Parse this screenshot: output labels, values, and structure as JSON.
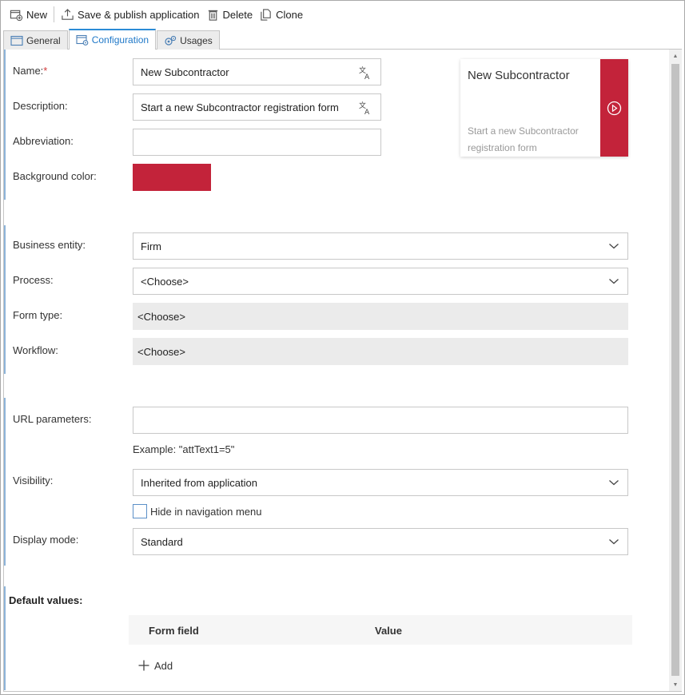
{
  "toolbar": {
    "new_label": "New",
    "save_publish_label": "Save & publish application",
    "delete_label": "Delete",
    "clone_label": "Clone"
  },
  "tabs": [
    {
      "label": "General",
      "icon": "window-icon"
    },
    {
      "label": "Configuration",
      "icon": "window-gear-icon"
    },
    {
      "label": "Usages",
      "icon": "gears-icon"
    }
  ],
  "form": {
    "name_label": "Name:",
    "required_mark": "*",
    "name_value": "New Subcontractor",
    "description_label": "Description:",
    "description_value": "Start a new Subcontractor registration form",
    "abbreviation_label": "Abbreviation:",
    "abbreviation_value": "",
    "background_color_label": "Background color:",
    "background_color": "#c3233a",
    "business_entity_label": "Business entity:",
    "business_entity_value": "Firm",
    "process_label": "Process:",
    "process_value": "<Choose>",
    "form_type_label": "Form type:",
    "form_type_value": "<Choose>",
    "workflow_label": "Workflow:",
    "workflow_value": "<Choose>",
    "url_parameters_label": "URL parameters:",
    "url_parameters_value": "",
    "url_example": "Example: \"attText1=5\"",
    "visibility_label": "Visibility:",
    "visibility_value": "Inherited from application",
    "hide_in_nav_label": "Hide in navigation menu",
    "hide_in_nav_checked": false,
    "display_mode_label": "Display mode:",
    "display_mode_value": "Standard"
  },
  "preview": {
    "title": "New Subcontractor",
    "description": "Start a new Subcontractor registration form",
    "icon": "play-circle-icon"
  },
  "default_values": {
    "title": "Default values:",
    "columns": [
      "Form field",
      "Value"
    ],
    "add_label": "Add"
  },
  "colors": {
    "accent": "#c3233a",
    "tab_active": "#1f78c8",
    "section_bar": "#8db4d9"
  }
}
